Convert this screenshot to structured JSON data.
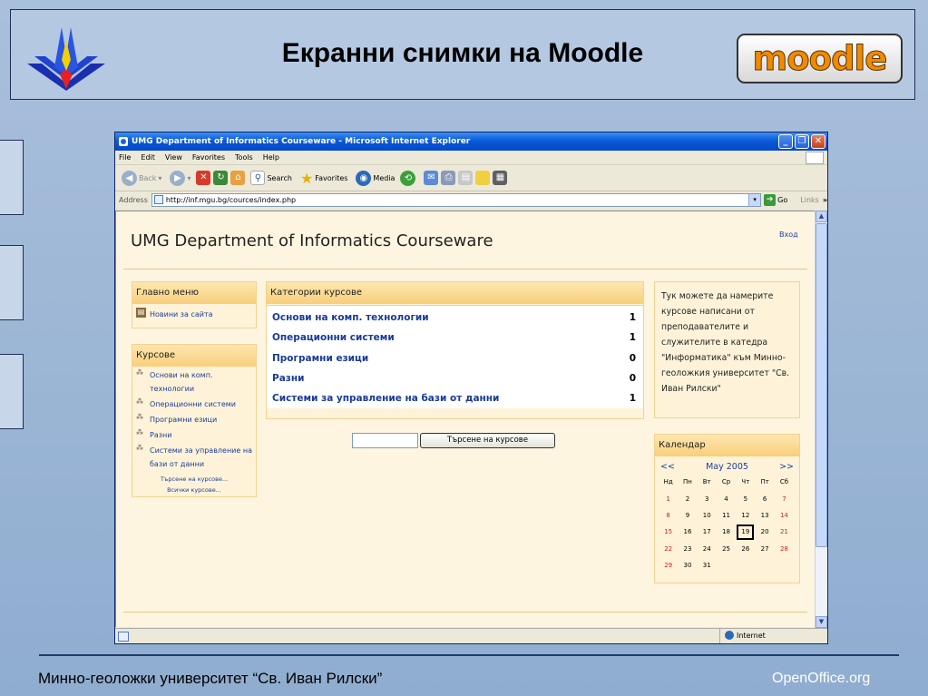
{
  "slide": {
    "title": "Екранни снимки на Moodle",
    "moodle_logo": "moodle",
    "footer_left": "Минно-геоложки университет “Св. Иван Рилски”",
    "footer_right": "OpenOffice.org"
  },
  "browser": {
    "window_title": "UMG Department of Informatics Courseware - Microsoft Internet Explorer",
    "menu": [
      "File",
      "Edit",
      "View",
      "Favorites",
      "Tools",
      "Help"
    ],
    "toolbar": {
      "back": "Back",
      "search": "Search",
      "favorites": "Favorites",
      "media": "Media"
    },
    "address_label": "Address",
    "url": "http://inf.mgu.bg/cources/index.php",
    "go_label": "Go",
    "links_label": "Links",
    "status_zone": "Internet"
  },
  "site": {
    "title": "UMG Department of Informatics Courseware",
    "login": "Вход",
    "main_menu": {
      "title": "Главно меню",
      "items": [
        "Новини за сайта"
      ]
    },
    "courses_block": {
      "title": "Курсове",
      "items": [
        "Основи на комп. технологии",
        "Операционни системи",
        "Програмни езици",
        "Разни",
        "Системи за управление на бази от данни"
      ],
      "search_link": "Търсене на курсове...",
      "all_link": "Всички курсове..."
    },
    "categories": {
      "title": "Категории курсове",
      "rows": [
        {
          "name": "Основи на комп. технологии",
          "count": "1"
        },
        {
          "name": "Операционни системи",
          "count": "1"
        },
        {
          "name": "Програмни езици",
          "count": "0"
        },
        {
          "name": "Разни",
          "count": "0"
        },
        {
          "name": "Системи за управление на бази от данни",
          "count": "1"
        }
      ]
    },
    "search_button": "Търсене на курсове",
    "info_text": "Тук можете да намерите курсове написани от преподавателите и служителите в катедра \"Информатика\" към Минно-геоложкия университет \"Св. Иван Рилски\"",
    "calendar": {
      "title": "Календар",
      "prev": "<<",
      "next": ">>",
      "month": "May 2005",
      "weekdays": [
        "Нд",
        "Пн",
        "Вт",
        "Ср",
        "Чт",
        "Пт",
        "Сб"
      ],
      "weeks": [
        [
          "1",
          "2",
          "3",
          "4",
          "5",
          "6",
          "7"
        ],
        [
          "8",
          "9",
          "10",
          "11",
          "12",
          "13",
          "14"
        ],
        [
          "15",
          "16",
          "17",
          "18",
          "19",
          "20",
          "21"
        ],
        [
          "22",
          "23",
          "24",
          "25",
          "26",
          "27",
          "28"
        ],
        [
          "29",
          "30",
          "31",
          "",
          "",
          "",
          ""
        ]
      ],
      "today": "19"
    }
  }
}
